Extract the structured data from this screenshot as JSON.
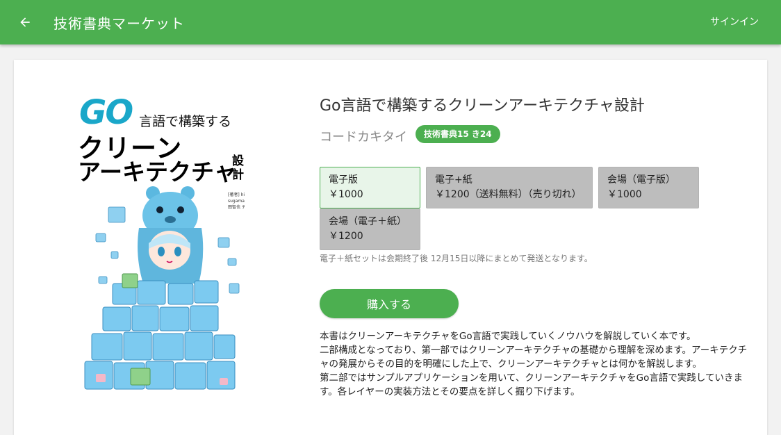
{
  "appbar": {
    "title": "技術書典マーケット",
    "signin_label": "サインイン",
    "back_icon": "arrow-left-icon"
  },
  "cover": {
    "go": "GO",
    "subtitle": "言語で構築する",
    "line1": "クリーン",
    "line2": "アーキテクチャ",
    "line3": "設計",
    "author": "[著者] hiroaki sugamaan 吉田智也 チャラ"
  },
  "book": {
    "title": "Go言語で構築するクリーンアーキテクチャ設計",
    "circle": "コードカキタイ",
    "booth": "技術書典15 き24"
  },
  "options": [
    {
      "name": "電子版",
      "price": "￥1000"
    },
    {
      "name": "電子+紙",
      "price": "￥1200（送料無料）（売り切れ）"
    },
    {
      "name": "会場（電子版）",
      "price": "￥1000"
    },
    {
      "name": "会場（電子＋紙）",
      "price": "￥1200"
    }
  ],
  "shipping_note": "電子＋紙セットは会期終了後 12月15日以降にまとめて発送となります。",
  "buy_label": "購入する",
  "description": [
    "本書はクリーンアーキテクチャをGo言語で実践していくノウハウを解説していく本です。",
    "二部構成となっており、第一部ではクリーンアーキテクチャの基礎から理解を深めます。アーキテクチャの発展からその目的を明確にした上で、クリーンアーキテクチャとは何かを解説します。",
    "第二部ではサンプルアプリケーションを用いて、クリーンアーキテクチャをGo言語で実践していきます。各レイヤーの実装方法とその要点を詳しく掘り下げます。"
  ],
  "colors": {
    "primary": "#4caf50",
    "selected_bg": "#e8f5e9",
    "disabled_bg": "#bdbdbd"
  }
}
